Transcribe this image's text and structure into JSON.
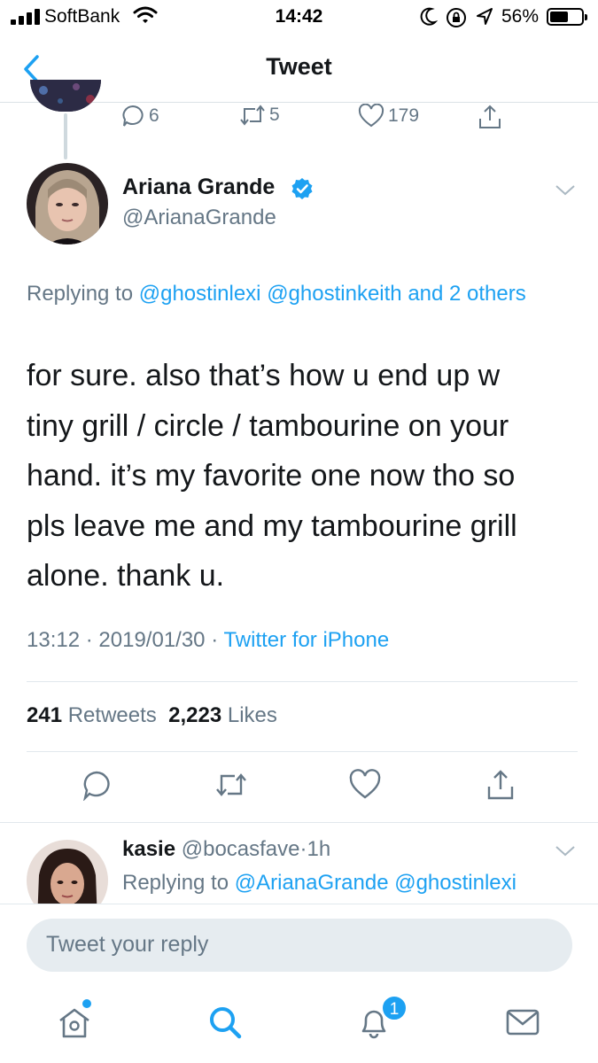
{
  "status_bar": {
    "carrier": "SoftBank",
    "time": "14:42",
    "battery": "56%"
  },
  "nav": {
    "title": "Tweet"
  },
  "previous_tweet": {
    "replies": "6",
    "retweets": "5",
    "likes": "179"
  },
  "tweet": {
    "author_name": "Ariana Grande",
    "author_handle": "@ArianaGrande",
    "replying_prefix": "Replying to",
    "replying_to": [
      "@ghostinlexi",
      "@ghostinkeith"
    ],
    "replying_others": "and 2 others",
    "text_lines": [
      "for sure. also that’s how u end up w",
      "tiny grill / circle / tambourine on your",
      "hand. it’s my favorite one now tho so",
      "pls leave me and my tambourine grill",
      "alone. thank u."
    ],
    "time": "13:12",
    "date": "2019/01/30",
    "source": "Twitter for iPhone",
    "retweet_count": "241",
    "retweet_label": "Retweets",
    "like_count": "2,223",
    "like_label": "Likes"
  },
  "reply": {
    "name": "kasie",
    "handle": "@bocasfave",
    "time_ago": "1h",
    "replying_prefix": "Replying to",
    "replying_to": [
      "@ArianaGrande",
      "@ghostinlexi"
    ]
  },
  "compose": {
    "placeholder": "Tweet your reply"
  },
  "tabbar": {
    "notification_badge": "1"
  },
  "colors": {
    "accent": "#1da1f2",
    "secondary_text": "#657786"
  }
}
